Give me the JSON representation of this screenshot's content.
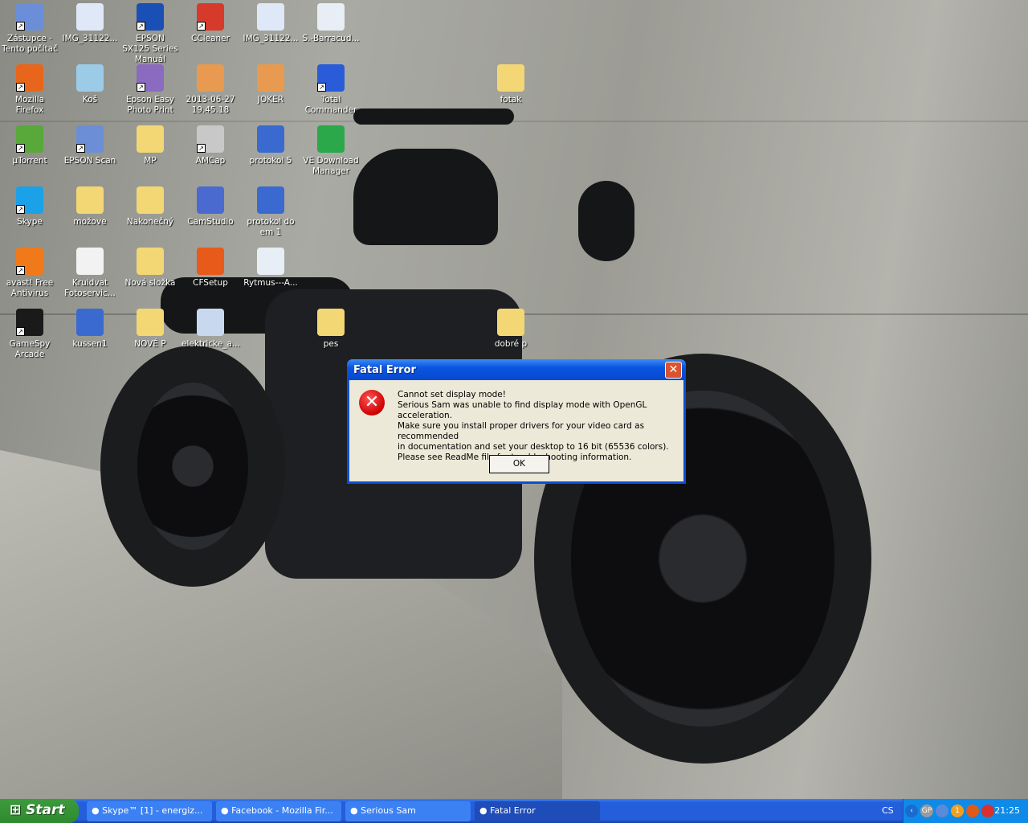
{
  "desktop": {
    "icons": [
      {
        "label": "Zástupce - Tento počítač",
        "icon": "my-computer-icon",
        "color": "#6a8fd8",
        "shortcut": true
      },
      {
        "label": "IMG_31122...",
        "icon": "image-file-icon",
        "color": "#dfe8f7",
        "shortcut": false
      },
      {
        "label": "EPSON SX125 Series Manuál",
        "icon": "epson-manual-icon",
        "color": "#1a4fb5",
        "shortcut": true
      },
      {
        "label": "CCleaner",
        "icon": "ccleaner-icon",
        "color": "#d63a2a",
        "shortcut": true
      },
      {
        "label": "IMG_31122...",
        "icon": "image-file-icon",
        "color": "#dfe8f7",
        "shortcut": false
      },
      {
        "label": "S.-Barracud...",
        "icon": "mp3-file-icon",
        "color": "#e8eef5",
        "shortcut": false
      },
      {
        "label": "Mozilla Firefox",
        "icon": "firefox-icon",
        "color": "#e8661c",
        "shortcut": true
      },
      {
        "label": "Koš",
        "icon": "recycle-bin-icon",
        "color": "#9ccbe8",
        "shortcut": false
      },
      {
        "label": "Epson Easy Photo Print",
        "icon": "photo-print-icon",
        "color": "#8a6bc0",
        "shortcut": true
      },
      {
        "label": "2013-06-27 19.45.18",
        "icon": "image-file-icon",
        "color": "#e79a50",
        "shortcut": false
      },
      {
        "label": "JOKER",
        "icon": "image-file-icon",
        "color": "#e79a50",
        "shortcut": false
      },
      {
        "label": "Total Commander",
        "icon": "floppy-disk-icon",
        "color": "#2a5bd8",
        "shortcut": true
      },
      {
        "label": "fotak",
        "icon": "folder-icon",
        "color": "#f3d774",
        "shortcut": false
      },
      {
        "label": "µTorrent",
        "icon": "utorrent-icon",
        "color": "#59a83a",
        "shortcut": true
      },
      {
        "label": "EPSON Scan",
        "icon": "scanner-icon",
        "color": "#6b8ed6",
        "shortcut": true
      },
      {
        "label": "MP",
        "icon": "folder-icon",
        "color": "#f3d774",
        "shortcut": false
      },
      {
        "label": "AMCap",
        "icon": "webcam-icon",
        "color": "#c8c8c8",
        "shortcut": true
      },
      {
        "label": "protokol 5",
        "icon": "word-document-icon",
        "color": "#3a6ad0",
        "shortcut": false
      },
      {
        "label": "VE Download Manager",
        "icon": "download-arrow-icon",
        "color": "#2aa84a",
        "shortcut": false
      },
      {
        "label": "Skype",
        "icon": "skype-icon",
        "color": "#1aa1e8",
        "shortcut": true
      },
      {
        "label": "možove",
        "icon": "folder-icon",
        "color": "#f3d774",
        "shortcut": false
      },
      {
        "label": "Nakonečný",
        "icon": "folder-icon",
        "color": "#f3d774",
        "shortcut": false
      },
      {
        "label": "CamStudio",
        "icon": "camstudio-icon",
        "color": "#4a6ad0",
        "shortcut": false
      },
      {
        "label": "protokol do em 1",
        "icon": "word-document-icon",
        "color": "#3a6ad0",
        "shortcut": false
      },
      {
        "label": "avast! Free Antivirus",
        "icon": "avast-icon",
        "color": "#f07a1a",
        "shortcut": true
      },
      {
        "label": "Kruidvat Fotoservic...",
        "icon": "firefox-html-file-icon",
        "color": "#f2f2f2",
        "shortcut": false
      },
      {
        "label": "Nová složka",
        "icon": "folder-icon",
        "color": "#f3d774",
        "shortcut": false
      },
      {
        "label": "CFSetup",
        "icon": "clownfish-icon",
        "color": "#e85a1a",
        "shortcut": false
      },
      {
        "label": "Rytmus---A...",
        "icon": "mp3-file-icon",
        "color": "#e8eef5",
        "shortcut": false
      },
      {
        "label": "GameSpy Arcade",
        "icon": "gamespy-icon",
        "color": "#1a1a1a",
        "shortcut": true
      },
      {
        "label": "kussen1",
        "icon": "word-document-icon",
        "color": "#3a6ad0",
        "shortcut": false
      },
      {
        "label": "NOVÉ P",
        "icon": "folder-icon",
        "color": "#f3d774",
        "shortcut": false
      },
      {
        "label": "elektricke_a...",
        "icon": "document-shortcut-icon",
        "color": "#c8d8ef",
        "shortcut": false
      },
      {
        "label": "pes",
        "icon": "folder-icon",
        "color": "#f3d774",
        "shortcut": false
      },
      {
        "label": "dobré p",
        "icon": "folder-icon",
        "color": "#f3d774",
        "shortcut": false
      }
    ]
  },
  "dialog": {
    "title": "Fatal Error",
    "close": "✕",
    "error_icon": "error-icon",
    "lines": [
      "Cannot set display mode!",
      "Serious Sam was unable to find display mode with OpenGL acceleration.",
      "Make sure you install proper drivers for your video card as recommended",
      "in documentation and set your desktop to 16 bit (65536 colors).",
      "Please see ReadMe file for troubleshooting information."
    ],
    "ok": "OK"
  },
  "taskbar": {
    "start": "Start",
    "tasks": [
      {
        "label": "Skype™ [1] - energiz...",
        "icon": "skype-icon",
        "active": false
      },
      {
        "label": "Facebook - Mozilla Fir...",
        "icon": "firefox-icon",
        "active": false
      },
      {
        "label": "Serious Sam",
        "icon": "folder-icon",
        "active": false
      },
      {
        "label": "Fatal Error",
        "icon": "serious-sam-icon",
        "active": true
      }
    ],
    "language": "CS",
    "clock": "21:25",
    "tray": [
      {
        "icon": "show-hidden-icons-chevron",
        "text": "‹"
      },
      {
        "icon": "gp-icon",
        "text": "GP"
      },
      {
        "icon": "network-icon",
        "text": ""
      },
      {
        "icon": "notification-badge-icon",
        "text": "1"
      },
      {
        "icon": "avast-tray-icon",
        "text": ""
      },
      {
        "icon": "red-app-tray-icon",
        "text": ""
      }
    ]
  }
}
